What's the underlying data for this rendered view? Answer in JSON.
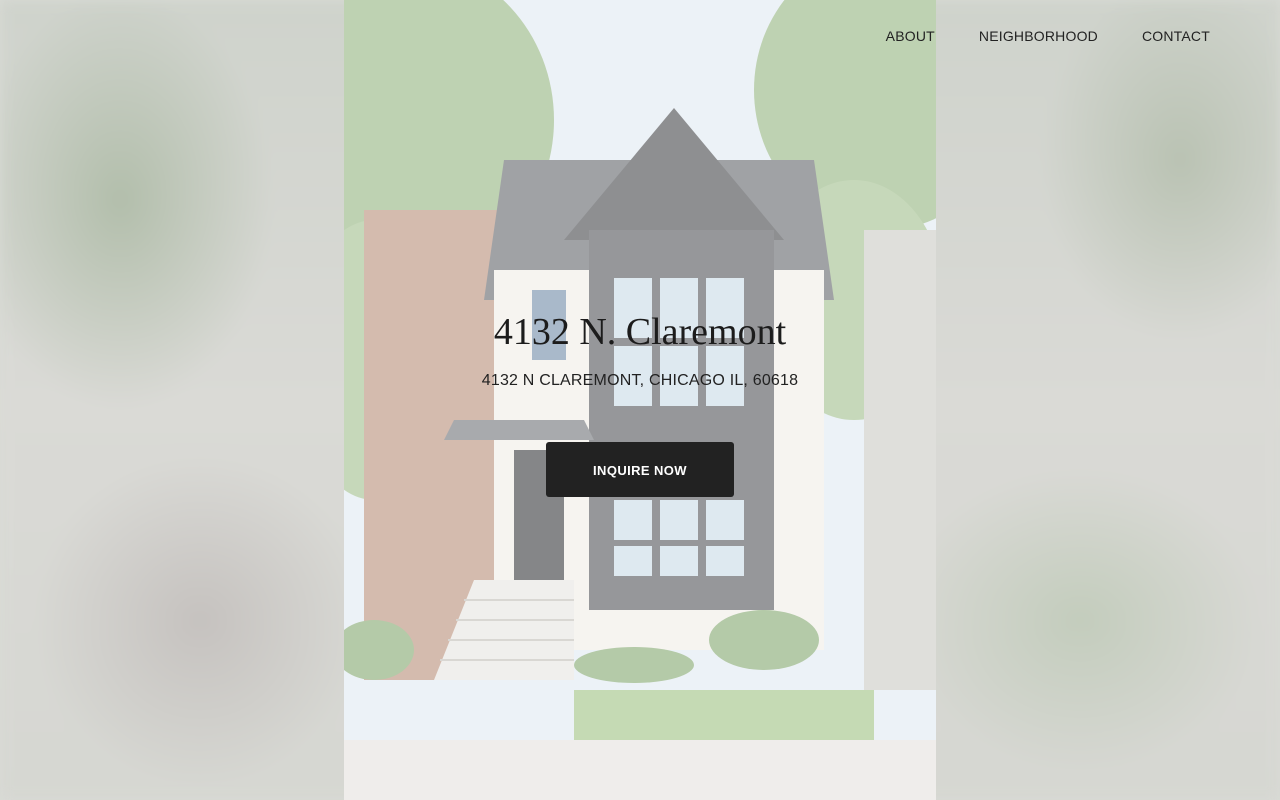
{
  "nav": {
    "items": [
      {
        "label": "ABOUT"
      },
      {
        "label": "NEIGHBORHOOD"
      },
      {
        "label": "CONTACT"
      }
    ]
  },
  "hero": {
    "title": "4132 N. Claremont",
    "address": "4132 N CLAREMONT, CHICAGO IL, 60618",
    "cta_label": "INQUIRE NOW"
  },
  "colors": {
    "button_bg": "#222222",
    "text": "#222222"
  }
}
